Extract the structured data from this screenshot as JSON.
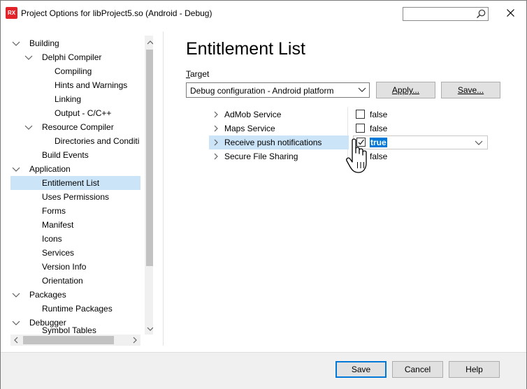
{
  "window": {
    "title": "Project Options for libProject5.so  (Android - Debug)",
    "icon_text": "RX",
    "search_placeholder": ""
  },
  "tree": {
    "items": [
      {
        "label": "Building",
        "level": 0,
        "expanded": true
      },
      {
        "label": "Delphi Compiler",
        "level": 1,
        "expanded": true
      },
      {
        "label": "Compiling",
        "level": 2
      },
      {
        "label": "Hints and Warnings",
        "level": 2
      },
      {
        "label": "Linking",
        "level": 2
      },
      {
        "label": "Output - C/C++",
        "level": 2
      },
      {
        "label": "Resource Compiler",
        "level": 1,
        "expanded": true
      },
      {
        "label": "Directories and Conditi",
        "level": 2
      },
      {
        "label": "Build Events",
        "level": 1
      },
      {
        "label": "Application",
        "level": 0,
        "expanded": true
      },
      {
        "label": "Entitlement List",
        "level": 1,
        "selected": true
      },
      {
        "label": "Uses Permissions",
        "level": 1
      },
      {
        "label": "Forms",
        "level": 1
      },
      {
        "label": "Manifest",
        "level": 1
      },
      {
        "label": "Icons",
        "level": 1
      },
      {
        "label": "Services",
        "level": 1
      },
      {
        "label": "Version Info",
        "level": 1
      },
      {
        "label": "Orientation",
        "level": 1
      },
      {
        "label": "Packages",
        "level": 0,
        "expanded": true
      },
      {
        "label": "Runtime Packages",
        "level": 1
      },
      {
        "label": "Debugger",
        "level": 0,
        "expanded": true
      },
      {
        "label": "Symbol Tables",
        "level": 1,
        "partial": true
      }
    ]
  },
  "main": {
    "title": "Entitlement List",
    "target_label": "Target",
    "target_value": "Debug configuration - Android platform",
    "apply_label": "Apply...",
    "save_target_label": "Save...",
    "entitlements": [
      {
        "name": "AdMob Service",
        "value": "false",
        "checked": false
      },
      {
        "name": "Maps Service",
        "value": "false",
        "checked": false
      },
      {
        "name": "Receive push notifications",
        "value": "true",
        "checked": true,
        "editing": true
      },
      {
        "name": "Secure File Sharing",
        "value": "false",
        "checked": false
      }
    ]
  },
  "footer": {
    "save_label": "Save",
    "cancel_label": "Cancel",
    "help_label": "Help"
  },
  "colors": {
    "selection": "#cce4f7",
    "accent": "#0078d7",
    "rx_red": "#e2232a"
  }
}
